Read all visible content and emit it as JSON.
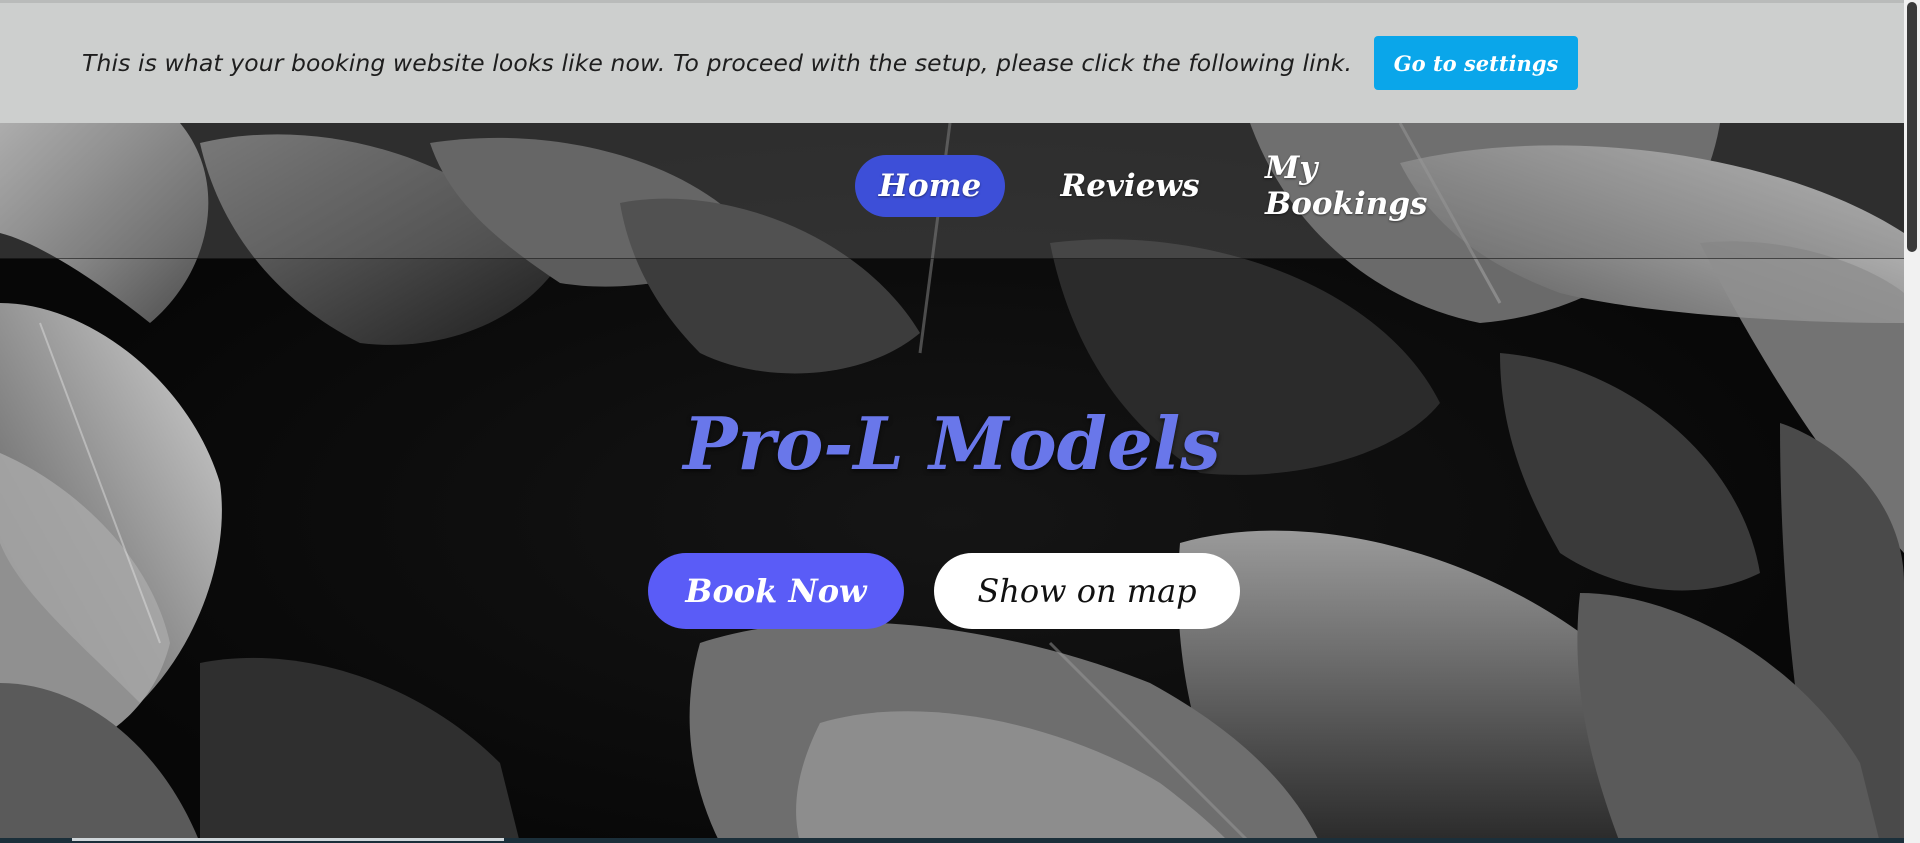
{
  "banner": {
    "message": "This is what your booking website looks like now. To proceed with the setup, please click the following link.",
    "settings_label": "Go to settings"
  },
  "nav": {
    "items": [
      {
        "label": "Home",
        "active": true
      },
      {
        "label": "Reviews",
        "active": false
      },
      {
        "label": "My Bookings",
        "active": false
      }
    ]
  },
  "hero": {
    "title": "Pro-L Models",
    "book_label": "Book Now",
    "map_label": "Show on map",
    "background_icon": "monstera-leaves-image"
  },
  "colors": {
    "banner_bg": "#cdcfce",
    "settings_button": "#0aa6ea",
    "nav_active": "#3d4fd8",
    "title": "#6977ea",
    "book_button": "#5a5cf7",
    "map_button": "#ffffff"
  }
}
